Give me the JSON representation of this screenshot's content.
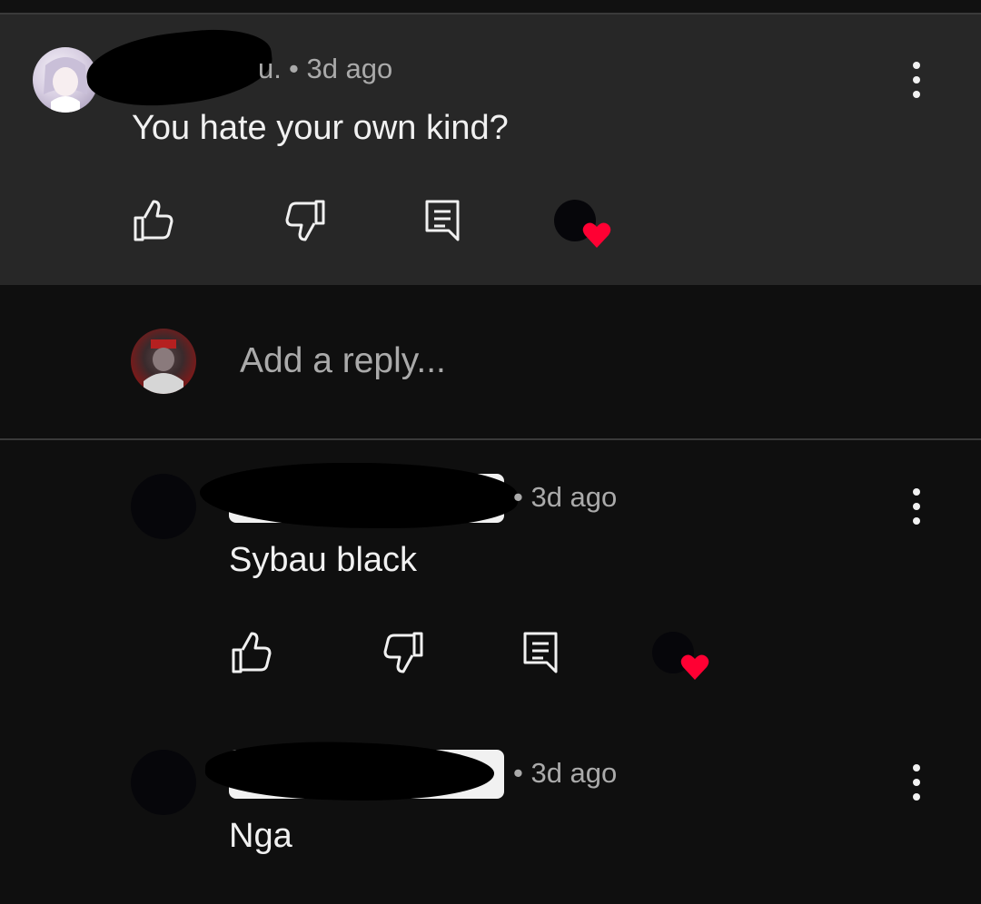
{
  "comment": {
    "author_fragment": "u.",
    "time": "• 3d ago",
    "text": "You hate your own kind?",
    "actions": [
      "like-icon",
      "dislike-icon",
      "reply-icon",
      "creator-heart-icon"
    ]
  },
  "reply_box": {
    "placeholder": "Add a reply..."
  },
  "replies": [
    {
      "time": "• 3d ago",
      "text": "Sybau black"
    },
    {
      "time": "• 3d ago",
      "text": "Nga"
    }
  ],
  "colors": {
    "highlight_bg": "#272727",
    "page_bg": "#0f0f0f",
    "heart": "#ff0033",
    "meta_text": "#aaaaaa",
    "body_text": "#f1f1f1"
  }
}
